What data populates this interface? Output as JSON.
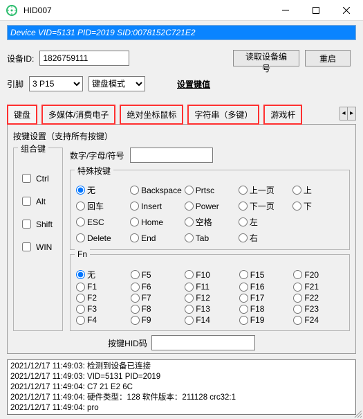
{
  "window": {
    "title": "HID007"
  },
  "banner": "Device VID=5131 PID=2019  SID:0078152C721E2",
  "row1": {
    "device_id_label": "设备ID:",
    "device_id_value": "1826759111",
    "read_id_btn": "读取设备编号",
    "reboot_btn": "重启"
  },
  "row2": {
    "pin_label": "引脚",
    "pin_value": "3 P15",
    "mode_value": "键盘模式",
    "set_value_link": "设置键值"
  },
  "tabs": {
    "items": [
      "键盘",
      "多媒体/消费电子",
      "绝对坐标鼠标",
      "字符串（多键）",
      "游戏杆"
    ],
    "active_index": 0,
    "content_subtitle": "按键设置（支持所有按键）"
  },
  "modifiers": {
    "legend": "组合键",
    "items": [
      "Ctrl",
      "Alt",
      "Shift",
      "WIN"
    ]
  },
  "char_input": {
    "label": "数字/字母/符号",
    "value": ""
  },
  "special": {
    "legend": "特殊按键",
    "selected": "无",
    "rows": [
      [
        "无",
        "Backspace",
        "Prtsc",
        "上一页",
        "上"
      ],
      [
        "回车",
        "Insert",
        "Power",
        "下一页",
        "下"
      ],
      [
        "ESC",
        "Home",
        "空格",
        "左",
        ""
      ],
      [
        "Delete",
        "End",
        "Tab",
        "右",
        ""
      ]
    ]
  },
  "fn": {
    "legend": "Fn",
    "selected": "无",
    "rows": [
      [
        "无",
        "F5",
        "F10",
        "F15",
        "F20"
      ],
      [
        "F1",
        "F6",
        "F11",
        "F16",
        "F21"
      ],
      [
        "F2",
        "F7",
        "F12",
        "F17",
        "F22"
      ],
      [
        "F3",
        "F8",
        "F13",
        "F18",
        "F23"
      ],
      [
        "F4",
        "F9",
        "F14",
        "F19",
        "F24"
      ]
    ]
  },
  "hid": {
    "label": "按键HID码",
    "value": ""
  },
  "log": [
    "2021/12/17 11:49:03: 检测到设备已连接",
    "2021/12/17 11:49:03: VID=5131 PID=2019",
    "2021/12/17 11:49:04: C7 21 E2 6C",
    "2021/12/17 11:49:04: 硬件类型：128  软件版本：211128  crc32:1",
    "2021/12/17 11:49:04: pro"
  ]
}
